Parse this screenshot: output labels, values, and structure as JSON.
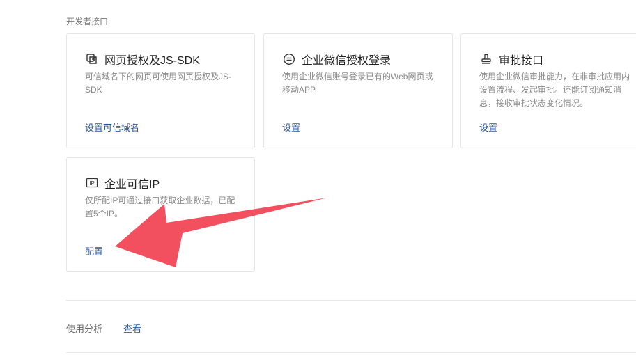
{
  "section": {
    "title": "开发者接口"
  },
  "cards": [
    {
      "icon": "copy-icon",
      "title": "网页授权及JS-SDK",
      "desc_line1": "可信域名下的网页可使用网页授权及JS-",
      "desc_line2": "SDK",
      "link": "设置可信域名"
    },
    {
      "icon": "chat-bubble-icon",
      "title": "企业微信授权登录",
      "desc_line1": "使用企业微信账号登录已有的Web网页或",
      "desc_line2": "移动APP",
      "link": "设置"
    },
    {
      "icon": "stamp-icon",
      "title": "审批接口",
      "desc_line1": "使用企业微信审批能力，在非审批应用内",
      "desc_line2": "设置流程、发起审批。还能订阅通知消",
      "desc_line3": "息，接收审批状态变化情况。",
      "link": "设置"
    },
    {
      "icon": "ip-icon",
      "icon_text": "IP",
      "title": "企业可信IP",
      "desc_line1": "仅所配IP可通过接口获取企业数据，已配",
      "desc_line2": "置5个IP。",
      "link": "配置"
    }
  ],
  "analysis": {
    "label": "使用分析",
    "link": "查看"
  },
  "colors": {
    "link": "#2b5797",
    "arrow": "#f2505f",
    "border": "#e4e6e9"
  }
}
